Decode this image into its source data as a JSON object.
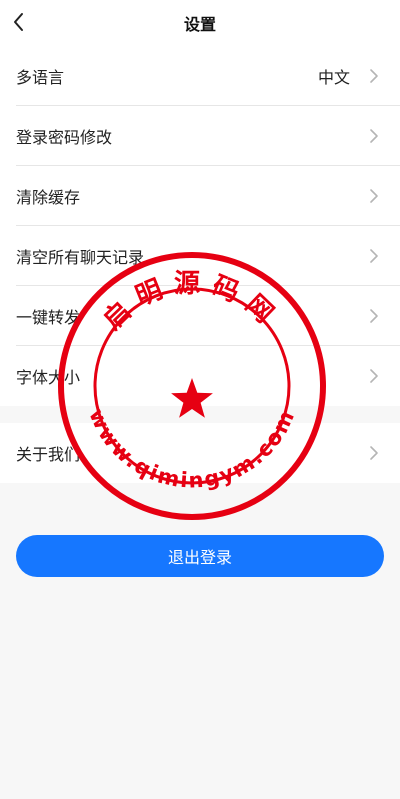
{
  "header": {
    "title": "设置",
    "back_icon": "chevron-left-icon"
  },
  "settings": {
    "group1": [
      {
        "label": "多语言",
        "value": "中文"
      },
      {
        "label": "登录密码修改"
      },
      {
        "label": "清除缓存"
      },
      {
        "label": "清空所有聊天记录"
      },
      {
        "label": "一键转发"
      },
      {
        "label": "字体大小"
      }
    ],
    "group2": [
      {
        "label": "关于我们"
      }
    ]
  },
  "logout": {
    "label": "退出登录"
  },
  "watermark": {
    "top_text": "启明源码网",
    "bottom_text": "www.qimingym.com",
    "color": "#e60012"
  },
  "colors": {
    "accent": "#1677ff",
    "background": "#f7f7f7"
  }
}
